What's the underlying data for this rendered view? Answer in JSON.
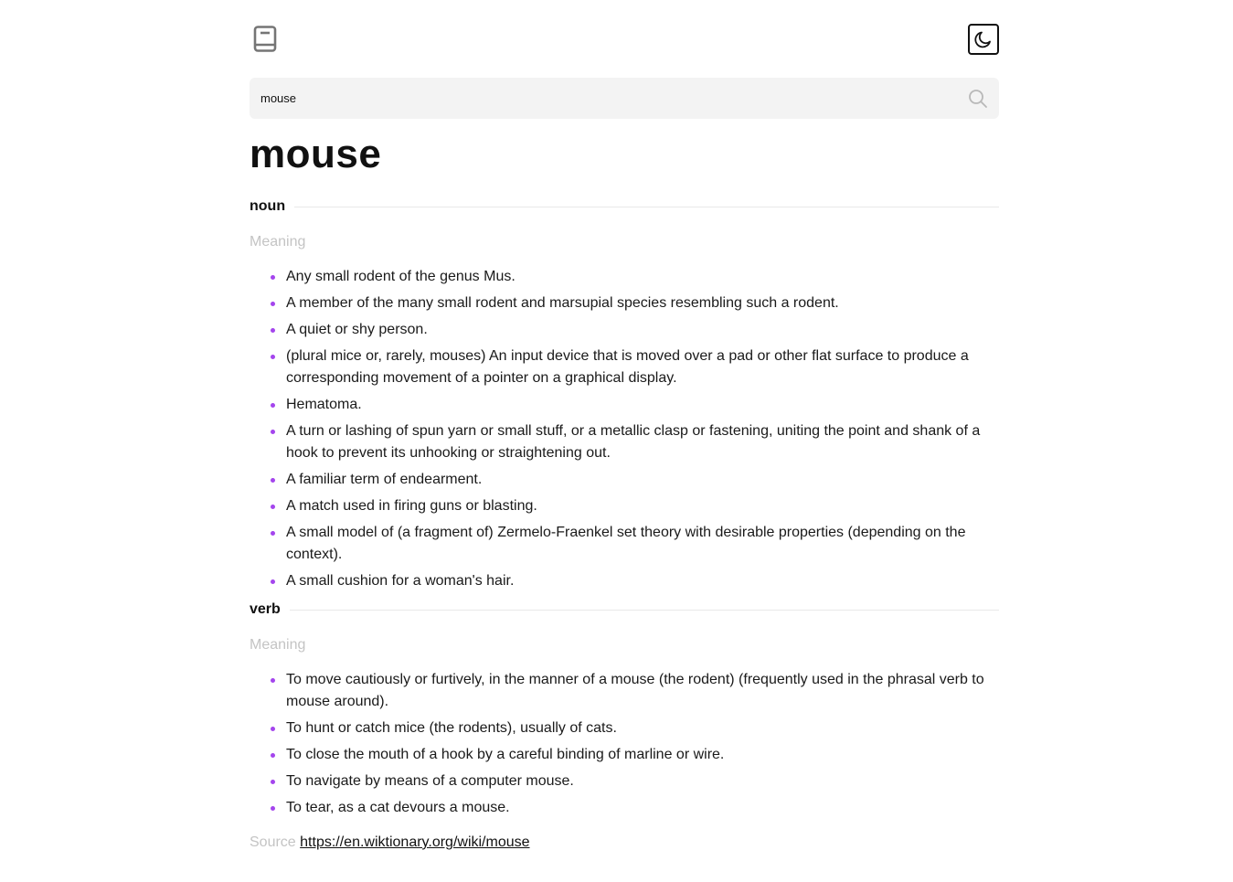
{
  "header": {
    "logo_icon": "book-icon",
    "theme_icon": "moon-icon"
  },
  "search": {
    "value": "mouse",
    "icon": "search-icon"
  },
  "word": "mouse",
  "meanings": [
    {
      "part_of_speech": "noun",
      "heading": "Meaning",
      "definitions": [
        "Any small rodent of the genus Mus.",
        "A member of the many small rodent and marsupial species resembling such a rodent.",
        "A quiet or shy person.",
        "(plural mice or, rarely, mouses) An input device that is moved over a pad or other flat surface to produce a corresponding movement of a pointer on a graphical display.",
        "Hematoma.",
        "A turn or lashing of spun yarn or small stuff, or a metallic clasp or fastening, uniting the point and shank of a hook to prevent its unhooking or straightening out.",
        "A familiar term of endearment.",
        "A match used in firing guns or blasting.",
        "A small model of (a fragment of) Zermelo-Fraenkel set theory with desirable properties (depending on the context).",
        "A small cushion for a woman's hair."
      ]
    },
    {
      "part_of_speech": "verb",
      "heading": "Meaning",
      "definitions": [
        "To move cautiously or furtively, in the manner of a mouse (the rodent) (frequently used in the phrasal verb to mouse around).",
        "To hunt or catch mice (the rodents), usually of cats.",
        "To close the mouth of a hook by a careful binding of marline or wire.",
        "To navigate by means of a computer mouse.",
        "To tear, as a cat devours a mouse."
      ]
    }
  ],
  "source": {
    "label": "Source",
    "url": "https://en.wiktionary.org/wiki/mouse"
  },
  "colors": {
    "accent": "#a445ed",
    "muted": "#c4c4c4",
    "search_bg": "#f3f3f3"
  }
}
